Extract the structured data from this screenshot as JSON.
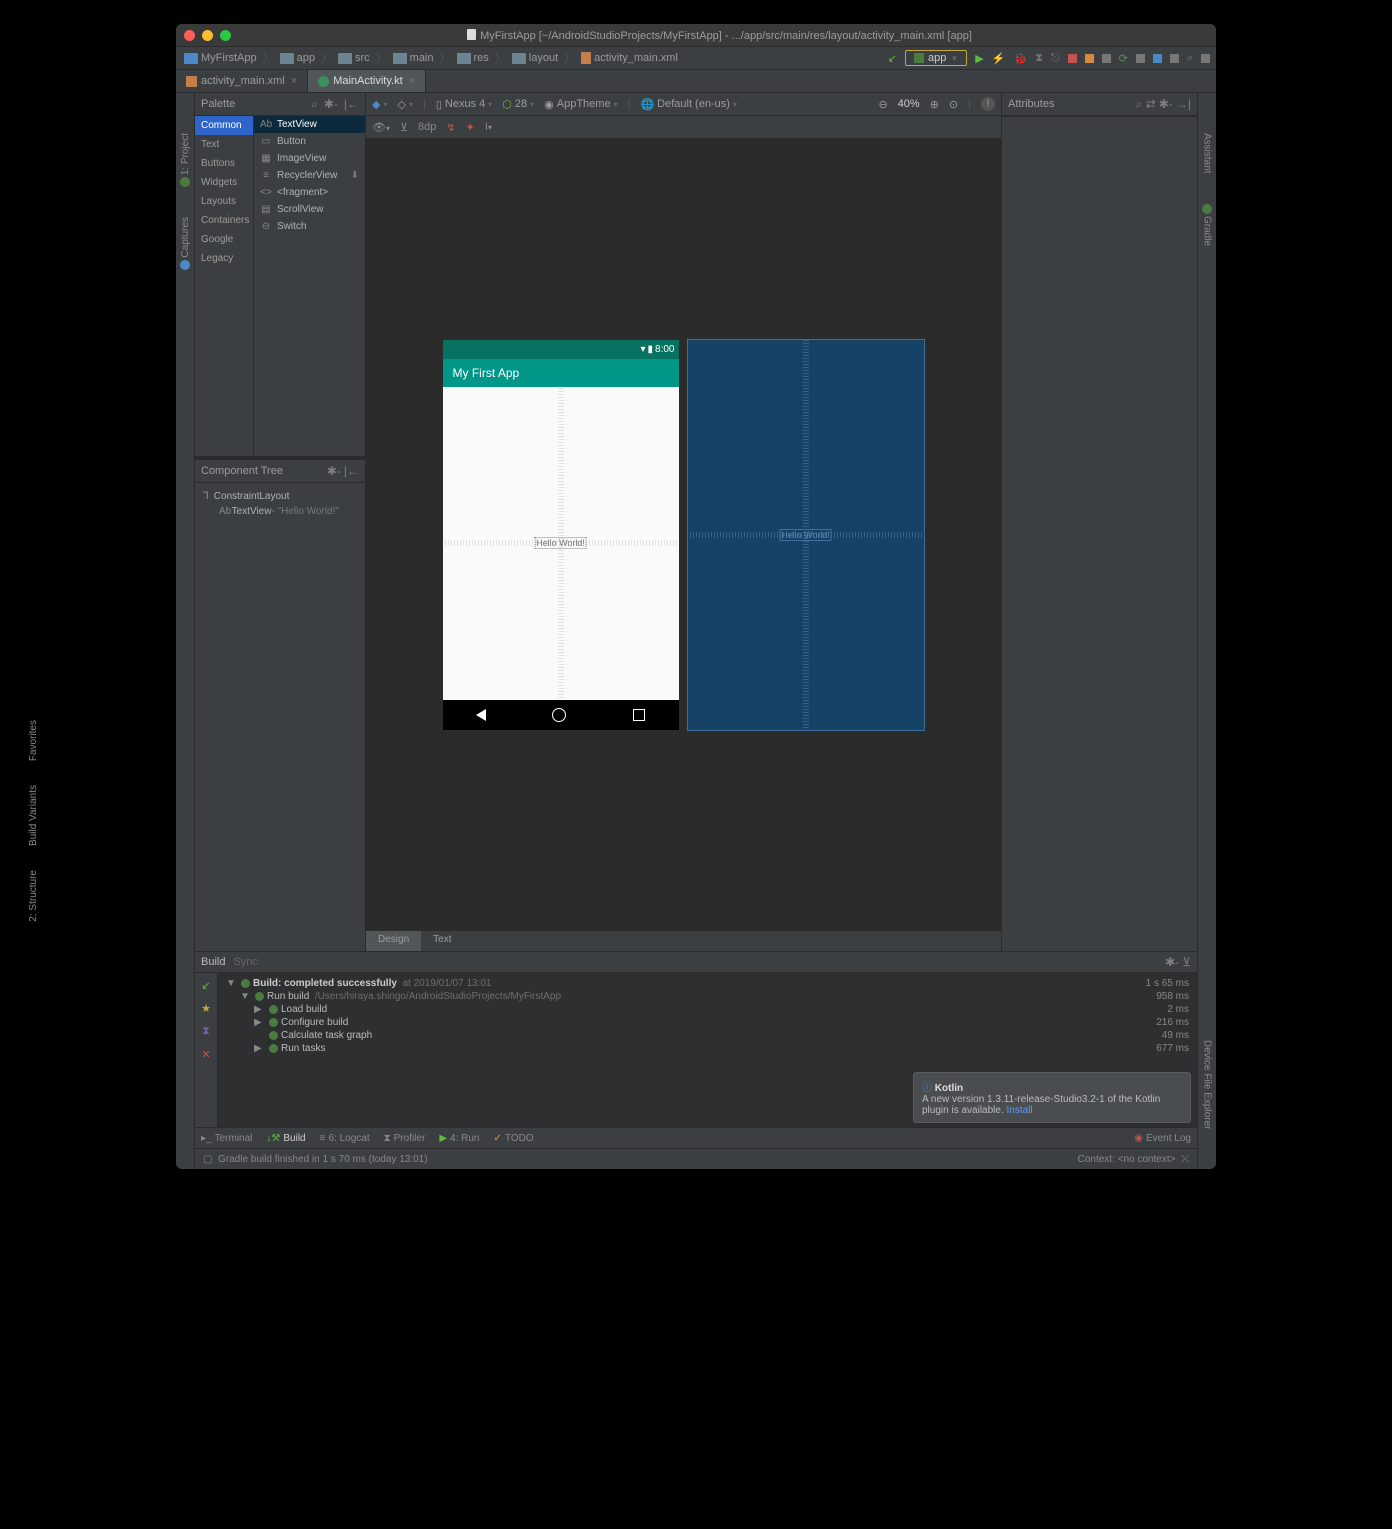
{
  "titlebar": {
    "title": "MyFirstApp [~/AndroidStudioProjects/MyFirstApp] - .../app/src/main/res/layout/activity_main.xml [app]"
  },
  "breadcrumb": [
    "MyFirstApp",
    "app",
    "src",
    "main",
    "res",
    "layout",
    "activity_main.xml"
  ],
  "toolbar_right": {
    "config": "app"
  },
  "tabs": [
    {
      "label": "activity_main.xml"
    },
    {
      "label": "MainActivity.kt"
    }
  ],
  "side_left": [
    {
      "label": "1: Project"
    },
    {
      "label": "Captures"
    }
  ],
  "side_right": [
    {
      "label": "Assistant"
    },
    {
      "label": "Gradle"
    }
  ],
  "side_left2": [
    {
      "label": "Favorites"
    },
    {
      "label": "Build Variants"
    },
    {
      "label": "2: Structure"
    }
  ],
  "side_right2": [
    {
      "label": "Device File Explorer"
    }
  ],
  "palette": {
    "header": "Palette",
    "categories": [
      "Common",
      "Text",
      "Buttons",
      "Widgets",
      "Layouts",
      "Containers",
      "Google",
      "Legacy"
    ],
    "items": [
      {
        "icon": "Ab",
        "label": "TextView"
      },
      {
        "icon": "▭",
        "label": "Button"
      },
      {
        "icon": "▦",
        "label": "ImageView"
      },
      {
        "icon": "≡",
        "label": "RecyclerView"
      },
      {
        "icon": "<>",
        "label": "<fragment>"
      },
      {
        "icon": "▤",
        "label": "ScrollView"
      },
      {
        "icon": "⊝",
        "label": "Switch"
      }
    ]
  },
  "component_tree": {
    "header": "Component Tree",
    "root": "ConstraintLayout",
    "child_type": "TextView",
    "child_label": "- \"Hello World!\""
  },
  "designbar": {
    "device": "Nexus 4",
    "api": "28",
    "theme": "AppTheme",
    "locale": "Default (en-us)",
    "zoom": "40%",
    "dp": "8dp"
  },
  "preview": {
    "clock": "8:00",
    "app_title": "My First App",
    "hello": "Hello World!"
  },
  "attrs": {
    "header": "Attributes"
  },
  "mode_tabs": [
    "Design",
    "Text"
  ],
  "build": {
    "tabs": [
      "Build",
      "Sync"
    ],
    "lines": [
      {
        "arrow": "▼",
        "text": "Build: completed successfully",
        "path": "at 2019/01/07 13:01",
        "time": "1 s 65 ms",
        "ind": 0,
        "bold": true
      },
      {
        "arrow": "▼",
        "text": "Run build",
        "path": "/Users/hiraya.shingo/AndroidStudioProjects/MyFirstApp",
        "time": "958 ms",
        "ind": 1
      },
      {
        "arrow": "▶",
        "text": "Load build",
        "time": "2 ms",
        "ind": 2
      },
      {
        "arrow": "▶",
        "text": "Configure build",
        "time": "216 ms",
        "ind": 2
      },
      {
        "arrow": "",
        "text": "Calculate task graph",
        "time": "49 ms",
        "ind": 2
      },
      {
        "arrow": "▶",
        "text": "Run tasks",
        "time": "677 ms",
        "ind": 2
      }
    ]
  },
  "notification": {
    "title": "Kotlin",
    "body": "A new version 1.3.11-release-Studio3.2-1 of the Kotlin plugin is available.",
    "action": "Install"
  },
  "bottom_bar": [
    "Terminal",
    "Build",
    "6: Logcat",
    "Profiler",
    "4: Run",
    "TODO"
  ],
  "status_bar": {
    "left": "Gradle build finished in 1 s 70 ms (today 13:01)",
    "right": "Context: <no context>",
    "event": "Event Log"
  }
}
